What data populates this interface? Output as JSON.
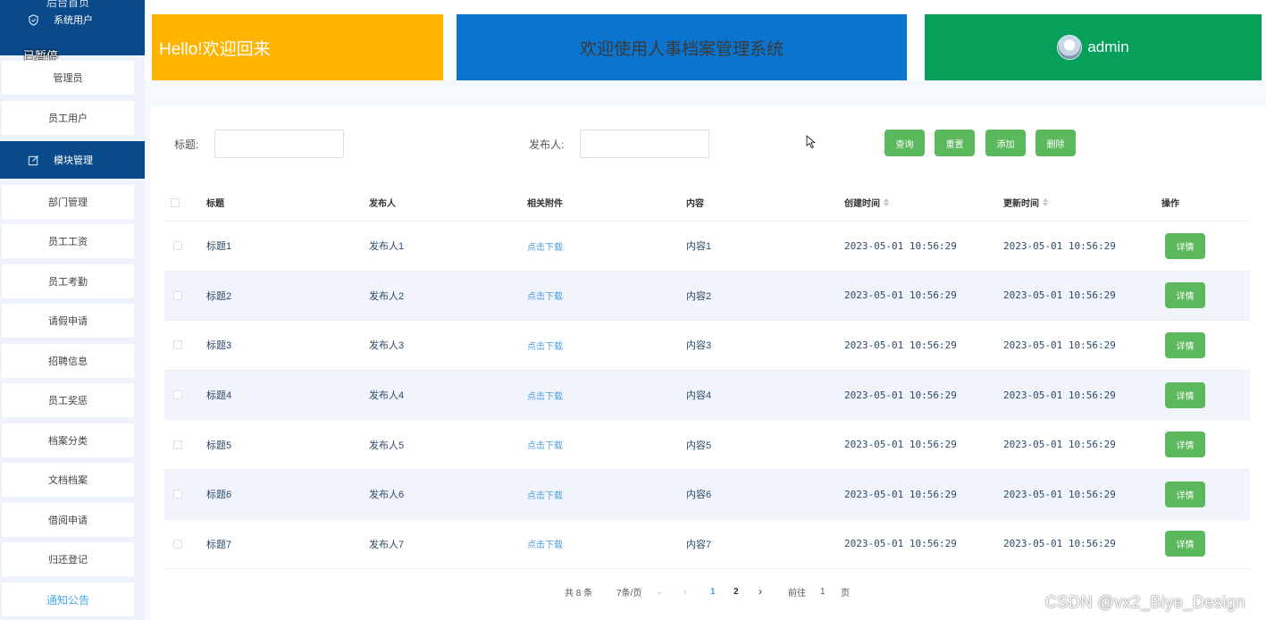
{
  "sidebar": {
    "top_partial_label": "后台首页",
    "paused_overlay": "已暂停",
    "group_system": "系统用户",
    "system_items": [
      "管理员",
      "员工用户"
    ],
    "group_module": "模块管理",
    "module_items": [
      "部门管理",
      "员工工资",
      "员工考勤",
      "请假申请",
      "招聘信息",
      "员工奖惩",
      "档案分类",
      "文档档案",
      "借阅申请",
      "归还登记"
    ],
    "notice_item": "通知公告"
  },
  "header": {
    "welcome": "Hello!欢迎回来",
    "system_title": "欢迎使用人事档案管理系统",
    "username": "admin"
  },
  "search": {
    "title_label": "标题:",
    "title_value": "",
    "publisher_label": "发布人:",
    "publisher_value": "",
    "query_btn": "查询",
    "reset_btn": "重置",
    "add_btn": "添加",
    "delete_btn": "删除"
  },
  "table": {
    "headers": {
      "title": "标题",
      "publisher": "发布人",
      "attachment": "相关附件",
      "content": "内容",
      "created": "创建时间",
      "updated": "更新时间",
      "actions": "操作"
    },
    "rows": [
      {
        "title": "标题1",
        "publisher": "发布人1",
        "attachment": "点击下载",
        "content": "内容1",
        "created": "2023-05-01 10:56:29",
        "updated": "2023-05-01 10:56:29",
        "action": "详情"
      },
      {
        "title": "标题2",
        "publisher": "发布人2",
        "attachment": "点击下载",
        "content": "内容2",
        "created": "2023-05-01 10:56:29",
        "updated": "2023-05-01 10:56:29",
        "action": "详情"
      },
      {
        "title": "标题3",
        "publisher": "发布人3",
        "attachment": "点击下载",
        "content": "内容3",
        "created": "2023-05-01 10:56:29",
        "updated": "2023-05-01 10:56:29",
        "action": "详情"
      },
      {
        "title": "标题4",
        "publisher": "发布人4",
        "attachment": "点击下载",
        "content": "内容4",
        "created": "2023-05-01 10:56:29",
        "updated": "2023-05-01 10:56:29",
        "action": "详情"
      },
      {
        "title": "标题5",
        "publisher": "发布人5",
        "attachment": "点击下载",
        "content": "内容5",
        "created": "2023-05-01 10:56:29",
        "updated": "2023-05-01 10:56:29",
        "action": "详情"
      },
      {
        "title": "标题6",
        "publisher": "发布人6",
        "attachment": "点击下载",
        "content": "内容6",
        "created": "2023-05-01 10:56:29",
        "updated": "2023-05-01 10:56:29",
        "action": "详情"
      },
      {
        "title": "标题7",
        "publisher": "发布人7",
        "attachment": "点击下载",
        "content": "内容7",
        "created": "2023-05-01 10:56:29",
        "updated": "2023-05-01 10:56:29",
        "action": "详情"
      }
    ]
  },
  "pagination": {
    "total": "共 8 条",
    "page_size": "7条/页",
    "page1": "1",
    "page2": "2",
    "goto_label": "前往",
    "goto_value": "1",
    "page_suffix": "页"
  },
  "watermark": "CSDN @vx2_Biye_Design",
  "colors": {
    "sidebar_header": "#0a4a8a",
    "welcome_box": "#ffb400",
    "title_box": "#0b74cf",
    "user_box": "#06a05a",
    "button_green": "#5cb85c",
    "link_blue": "#4a9fe0"
  }
}
